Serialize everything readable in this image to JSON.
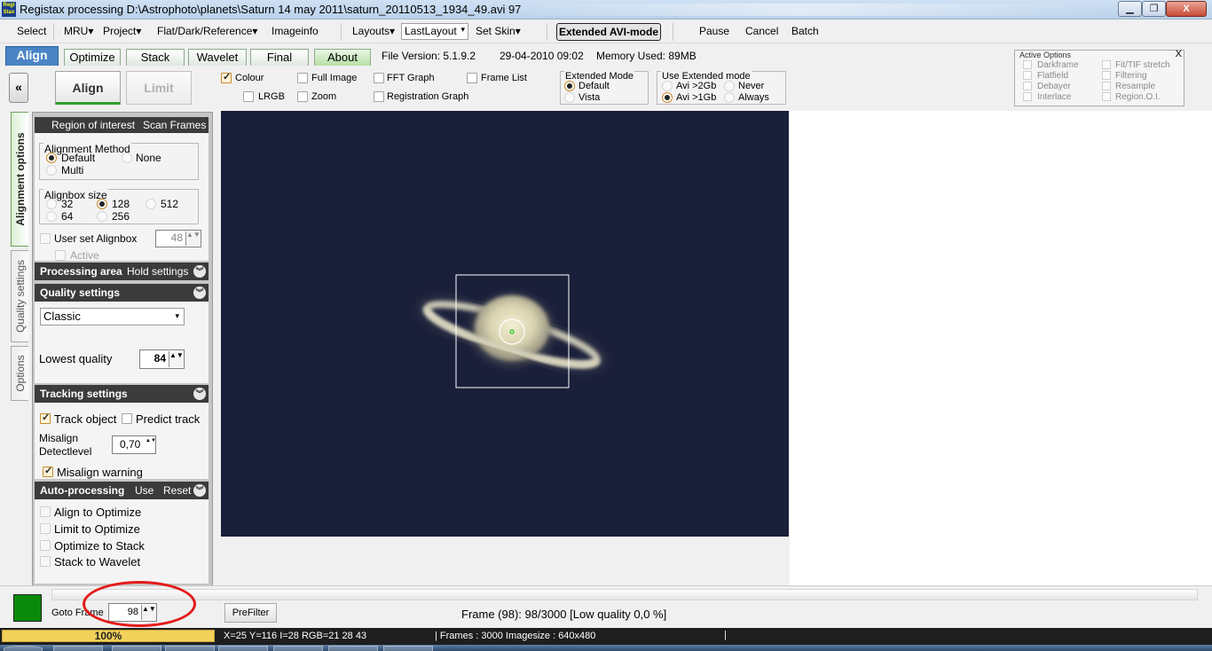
{
  "window": {
    "title": "Registax processing D:\\Astrophoto\\planets\\Saturn 14 may 2011\\saturn_20110513_1934_49.avi 97",
    "app_icon_text": "Regi Stax",
    "min_label": "▁",
    "max_label": "❐",
    "close_label": "X"
  },
  "menu": {
    "select": "Select",
    "mru": "MRU",
    "project": "Project",
    "flat": "Flat/Dark/Reference",
    "imageinfo": "Imageinfo",
    "layouts": "Layouts",
    "layout_value": "LastLayout",
    "set_skin": "Set Skin",
    "extended_avi": "Extended AVI-mode",
    "pause": "Pause",
    "cancel": "Cancel",
    "batch": "Batch",
    "dropdown_arrow": "▾"
  },
  "tabs": [
    "Align",
    "Optimize",
    "Stack",
    "Wavelet",
    "Final",
    "About"
  ],
  "info": {
    "file_version": "File Version: 5.1.9.2",
    "date": "29-04-2010 09:02",
    "memory": "Memory Used: 89MB"
  },
  "subtabs": {
    "collapse": "«",
    "align": "Align",
    "limit": "Limit"
  },
  "options_row": {
    "colour": "Colour",
    "lrgb": "LRGB",
    "full_image": "Full Image",
    "zoom": "Zoom",
    "fft_graph": "FFT Graph",
    "registration_graph": "Registration Graph",
    "frame_list": "Frame List"
  },
  "extended_mode": {
    "title": "Extended Mode",
    "default": "Default",
    "vista": "Vista"
  },
  "use_extended": {
    "title": "Use  Extended mode",
    "avi_2gb": "Avi >2Gb",
    "avi_1gb": "Avi >1Gb",
    "never": "Never",
    "always": "Always"
  },
  "active_options": {
    "title": "Active Options",
    "close": "X",
    "left": [
      "Darkframe",
      "Flatfield",
      "Debayer",
      "Interlace"
    ],
    "right": [
      "Fit/TIF stretch",
      "Filtering",
      "Resample",
      "Region.O.I."
    ]
  },
  "vertical_tabs": [
    "Alignment options",
    "Quality settings",
    "Options"
  ],
  "left_panel": {
    "roi_header": {
      "left": "Region of interest",
      "right": "Scan Frames"
    },
    "alignment_method": {
      "title": "Alignment Method",
      "default": "Default",
      "none": "None",
      "multi": "Multi"
    },
    "alignbox_size": {
      "title": "Alignbox size",
      "s32": "32",
      "s64": "64",
      "s128": "128",
      "s256": "256",
      "s512": "512"
    },
    "user_set_alignbox": "User set Alignbox",
    "alignbox_value": "48",
    "active": "Active",
    "processing_area": {
      "title": "Processing area",
      "right": "Hold settings"
    },
    "quality_settings": {
      "title": "Quality settings",
      "method": "Classic"
    },
    "lowest_quality": {
      "label": "Lowest quality",
      "value": "84"
    },
    "tracking_settings": {
      "title": "Tracking settings"
    },
    "track_object": "Track object",
    "predict_track": "Predict track",
    "misalign_label_1": "Misalign",
    "misalign_label_2": "Detectlevel",
    "misalign_value": "0,70",
    "misalign_warning": "Misalign warning",
    "auto_processing": {
      "title": "Auto-processing",
      "use": "Use",
      "reset": "Reset"
    },
    "auto_items": [
      "Align to Optimize",
      "Limit to Optimize",
      "Optimize to Stack",
      "Stack to Wavelet"
    ],
    "expand_icon": "︾",
    "spin_arrows": "▲▼"
  },
  "bottom": {
    "goto_frame": "Goto Frame",
    "goto_value": "98",
    "prefilter": "PreFilter",
    "frame_status": "Frame (98): 98/3000 [Low quality 0,0 %]"
  },
  "status": {
    "progress": "100%",
    "progress_value": 1.0,
    "coords": "X=25 Y=116 I=28 RGB=21 28 43",
    "frames": "| Frames : 3000 Imagesize : 640x480",
    "bar_sep": "|"
  },
  "colors": {
    "active_tab": "#4a84c4",
    "panel_header": "#3b3b3b",
    "image_bg": "#1a1f3a",
    "goto_color_box": "#0a8a0a",
    "annotation_circle": "#e41a1a",
    "progress": "#f2d25a"
  }
}
